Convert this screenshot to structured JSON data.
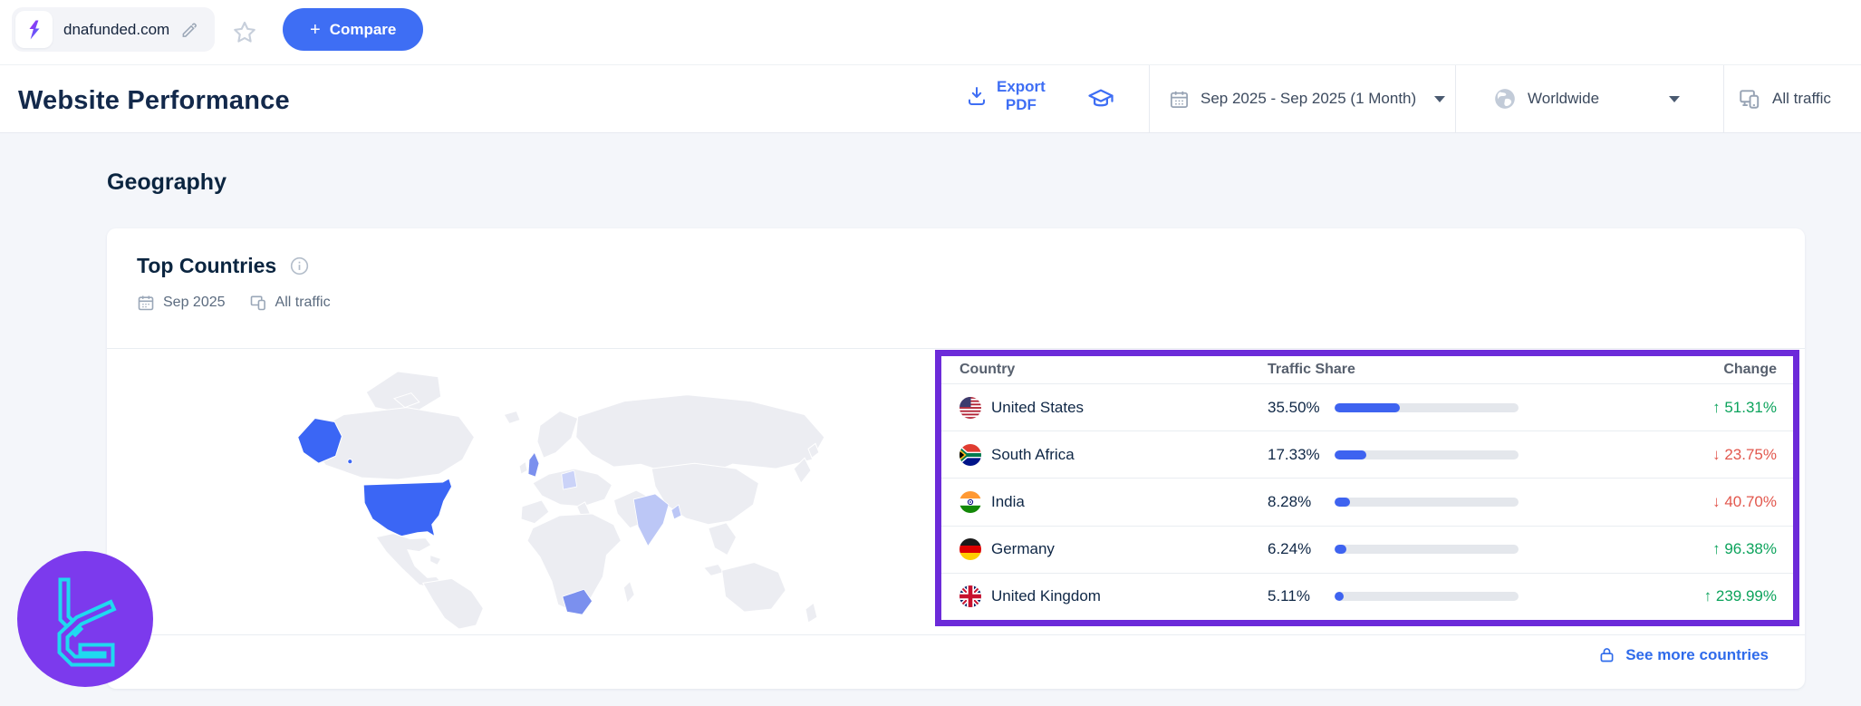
{
  "topbar": {
    "domain": "dnafunded.com",
    "compare_plus": "+",
    "compare_label": "Compare"
  },
  "header": {
    "title": "Website Performance",
    "export_line1": "Export",
    "export_line2": "PDF",
    "date_range": "Sep 2025 - Sep 2025 (1 Month)",
    "region": "Worldwide",
    "traffic": "All traffic"
  },
  "section": {
    "title": "Geography"
  },
  "card": {
    "title": "Top Countries",
    "period": "Sep 2025",
    "traffic": "All traffic",
    "see_more": "See more countries"
  },
  "table": {
    "headers": {
      "country": "Country",
      "share": "Traffic Share",
      "change": "Change"
    },
    "rows": [
      {
        "country": "United States",
        "flag": "us",
        "share": "35.50%",
        "share_value": 35.5,
        "change": "51.31%",
        "direction": "up"
      },
      {
        "country": "South Africa",
        "flag": "za",
        "share": "17.33%",
        "share_value": 17.33,
        "change": "23.75%",
        "direction": "down"
      },
      {
        "country": "India",
        "flag": "in",
        "share": "8.28%",
        "share_value": 8.28,
        "change": "40.70%",
        "direction": "down"
      },
      {
        "country": "Germany",
        "flag": "de",
        "share": "6.24%",
        "share_value": 6.24,
        "change": "96.38%",
        "direction": "up"
      },
      {
        "country": "United Kingdom",
        "flag": "gb",
        "share": "5.11%",
        "share_value": 5.11,
        "change": "239.99%",
        "direction": "up"
      }
    ]
  },
  "colors": {
    "accent": "#3e6ef4",
    "hl-border": "#6c2bd9",
    "bar": "#3e63f0",
    "green": "#0ca35c",
    "red": "#e2574d",
    "map-strong": "#3b66f5",
    "watermark-purple": "#7c3aed",
    "watermark-cyan": "#1fd9f0"
  }
}
